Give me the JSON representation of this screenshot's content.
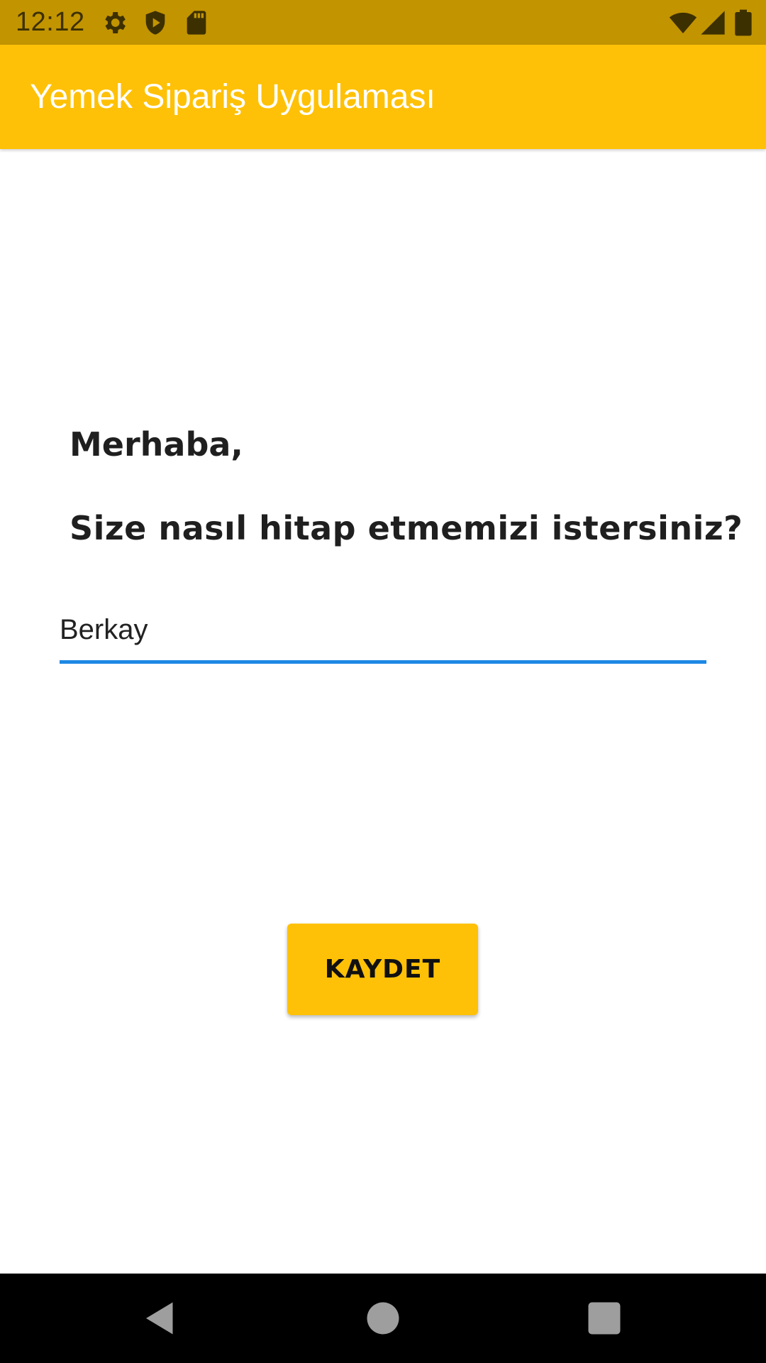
{
  "status_bar": {
    "time": "12:12",
    "icons": [
      "gear-icon",
      "shield-play-icon",
      "sd-card-icon",
      "wifi-icon",
      "signal-icon",
      "battery-icon"
    ],
    "background_color": "#C29400"
  },
  "app_bar": {
    "title": "Yemek Sipariş Uygulaması",
    "background_color": "#FFC107"
  },
  "main": {
    "greeting": "Merhaba,",
    "question": "Size nasıl hitap etmemizi istersiniz?",
    "name_input": {
      "value": "Berkay",
      "placeholder": ""
    },
    "input_accent_color": "#1E88E5",
    "save_button_label": "KAYDET",
    "button_color": "#FFC107"
  },
  "nav_bar": {
    "icons": [
      "back-icon",
      "home-icon",
      "recents-icon"
    ]
  }
}
